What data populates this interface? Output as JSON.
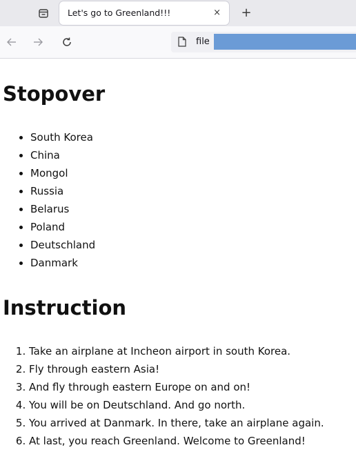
{
  "browser": {
    "tab": {
      "title": "Let's go to Greenland!!!",
      "close_glyph": "×"
    },
    "new_tab_glyph": "+",
    "url_text": "file",
    "redaction_color": "#6b9bd6"
  },
  "page": {
    "stopover": {
      "heading": "Stopover",
      "items": [
        "South Korea",
        "China",
        "Mongol",
        "Russia",
        "Belarus",
        "Poland",
        "Deutschland",
        "Danmark"
      ]
    },
    "instruction": {
      "heading": "Instruction",
      "steps": [
        "Take an airplane at Incheon airport in south Korea.",
        "Fly through eastern Asia!",
        "And fly through eastern Europe on and on!",
        "You will be on Deutschland. And go north.",
        "You arrived at Danmark. In there, take an airplane again.",
        "At last, you reach Greenland. Welcome to Greenland!"
      ]
    }
  },
  "icons": {
    "tab_list": "tab-list-icon",
    "back": "arrow-left-icon",
    "forward": "arrow-right-icon",
    "reload": "reload-icon",
    "page": "page-icon"
  }
}
